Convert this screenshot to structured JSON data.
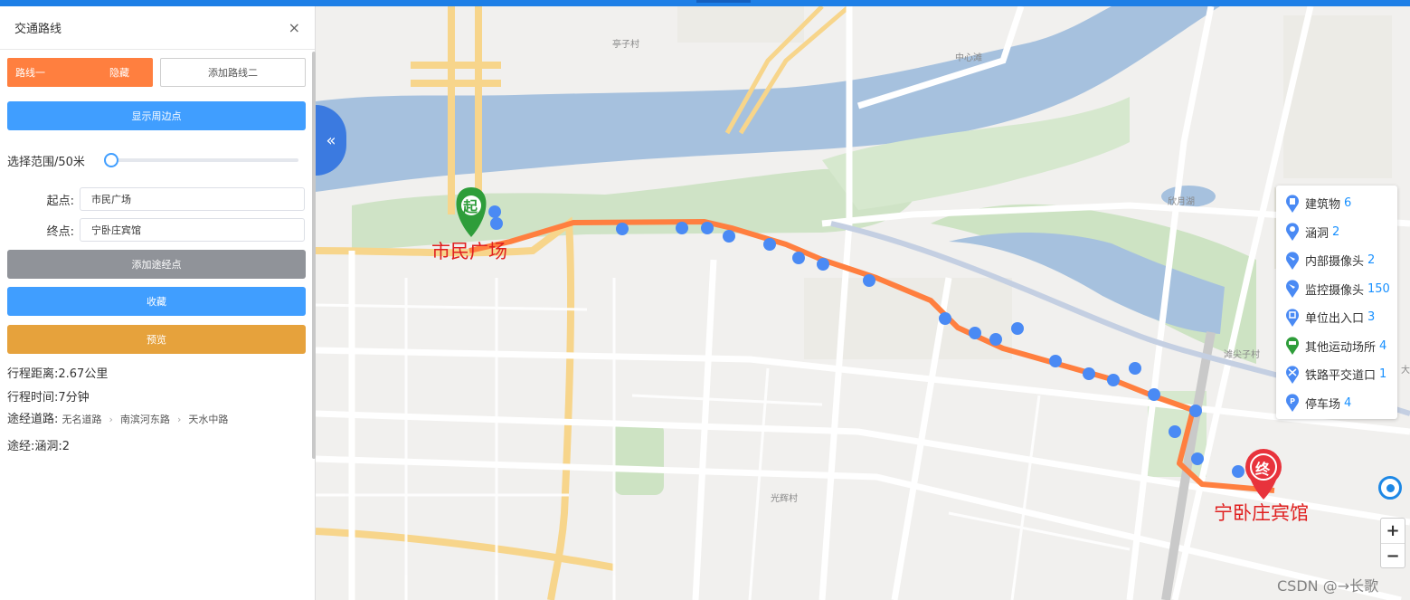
{
  "panel": {
    "title": "交通路线",
    "close": "×",
    "tabs": {
      "active_label": "路线一",
      "hide_label": "隐藏",
      "add_label": "添加路线二"
    },
    "show_around_label": "显示周边点",
    "range_label": "选择范围/50米",
    "range_value": 0,
    "start_label": "起点:",
    "start_value": "市民广场",
    "end_label": "终点:",
    "end_value": "宁卧庄宾馆",
    "add_waypoint_label": "添加途经点",
    "favorite_label": "收藏",
    "preview_label": "预览",
    "distance_text": "行程距离:2.67公里",
    "time_text": "行程时间:7分钟",
    "roads_label": "途经道路:",
    "roads": [
      "无名道路",
      "南滨河东路",
      "天水中路"
    ],
    "via_text": "途经:涵洞:2"
  },
  "map": {
    "collapse_icon": "«",
    "start_marker": "起",
    "end_marker": "终",
    "start_name": "市民广场",
    "end_name": "宁卧庄宾馆",
    "place_labels": [
      "亭子村",
      "中心滩",
      "欣月湖",
      "滩尖子村",
      "光辉村",
      "大"
    ],
    "route_color": "#ff7f3f",
    "legend": [
      {
        "name": "建筑物",
        "count": "6",
        "icon": "building-icon"
      },
      {
        "name": "涵洞",
        "count": "2",
        "icon": "culvert-icon"
      },
      {
        "name": "内部摄像头",
        "count": "2",
        "icon": "camera-icon"
      },
      {
        "name": "监控摄像头",
        "count": "150",
        "icon": "camera-icon"
      },
      {
        "name": "单位出入口",
        "count": "3",
        "icon": "entrance-icon"
      },
      {
        "name": "其他运动场所",
        "count": "4",
        "icon": "sports-icon"
      },
      {
        "name": "铁路平交道口",
        "count": "1",
        "icon": "railway-crossing-icon"
      },
      {
        "name": "停车场",
        "count": "4",
        "icon": "parking-icon"
      }
    ],
    "zoom_in": "+",
    "zoom_out": "−",
    "watermark": "CSDN @→长歌"
  }
}
